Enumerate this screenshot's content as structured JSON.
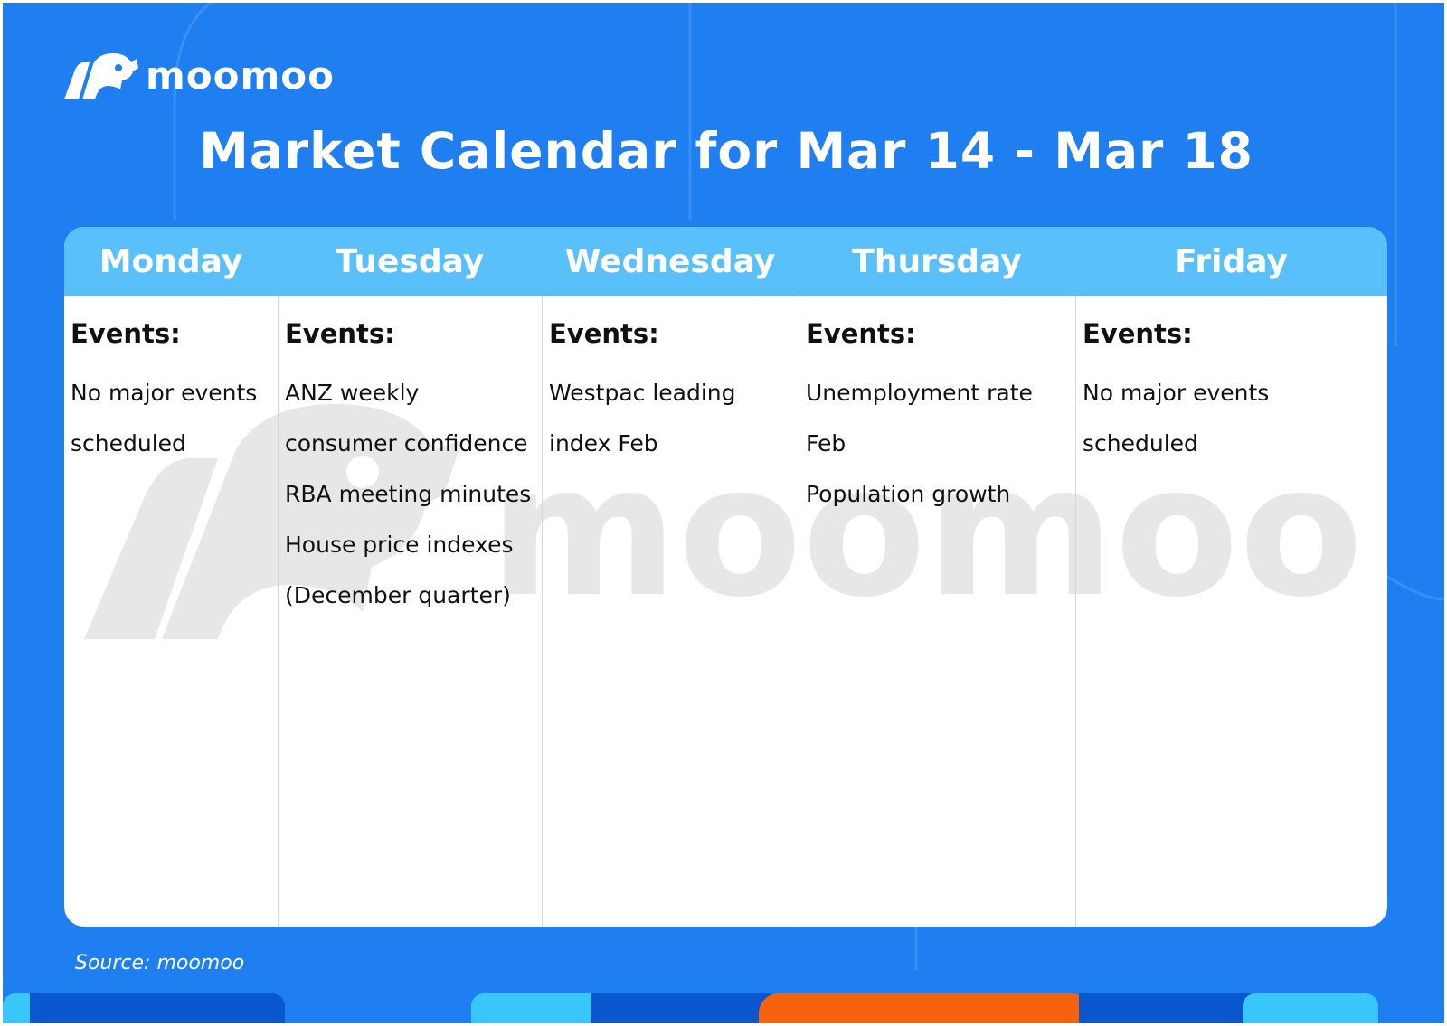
{
  "brand": {
    "name": "moomoo",
    "icon": "moomoo-bull-icon"
  },
  "title": "Market Calendar for Mar 14 - Mar 18",
  "days": [
    {
      "name": "Monday",
      "events_label": "Events:",
      "events": [
        "No major events scheduled"
      ]
    },
    {
      "name": "Tuesday",
      "events_label": "Events:",
      "events": [
        "ANZ weekly consumer confidence",
        "RBA meeting minutes",
        "House price indexes (December quarter)"
      ]
    },
    {
      "name": "Wednesday",
      "events_label": "Events:",
      "events": [
        "Westpac leading index Feb"
      ]
    },
    {
      "name": "Thursday",
      "events_label": "Events:",
      "events": [
        "Unemployment rate Feb",
        "Population growth"
      ]
    },
    {
      "name": "Friday",
      "events_label": "Events:",
      "events": [
        "No major events scheduled"
      ]
    }
  ],
  "watermark_text": "moomoo",
  "source": "Source: moomoo",
  "colors": {
    "background": "#1f7ff0",
    "header": "#5ac0fb",
    "card": "#ffffff",
    "bar_dark": "#0b57d0",
    "bar_light": "#38c6fb",
    "bar_orange": "#f7620f"
  }
}
